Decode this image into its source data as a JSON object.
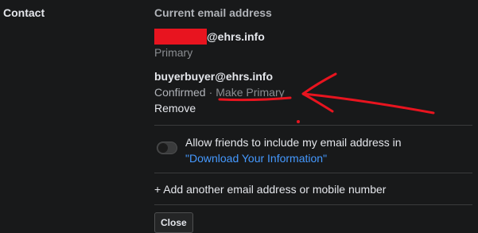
{
  "section": {
    "label": "Contact"
  },
  "current_email": {
    "heading": "Current email address",
    "email1_domain": "@ehrs.info",
    "email1_status": "Primary",
    "email2": "buyerbuyer@ehrs.info",
    "email2_status": "Confirmed",
    "separator": "·",
    "make_primary": "Make Primary",
    "remove": "Remove"
  },
  "allow_friends": {
    "text": "Allow friends to include my email address in ",
    "link": "\"Download Your Information\"",
    "enabled": false
  },
  "add_contact": {
    "label": "+ Add another email address or mobile number"
  },
  "close_button": {
    "label": "Close"
  },
  "colors": {
    "background": "#18191a",
    "link": "#4599ff",
    "annotation": "#e8141f",
    "redaction": "#e8141f"
  }
}
